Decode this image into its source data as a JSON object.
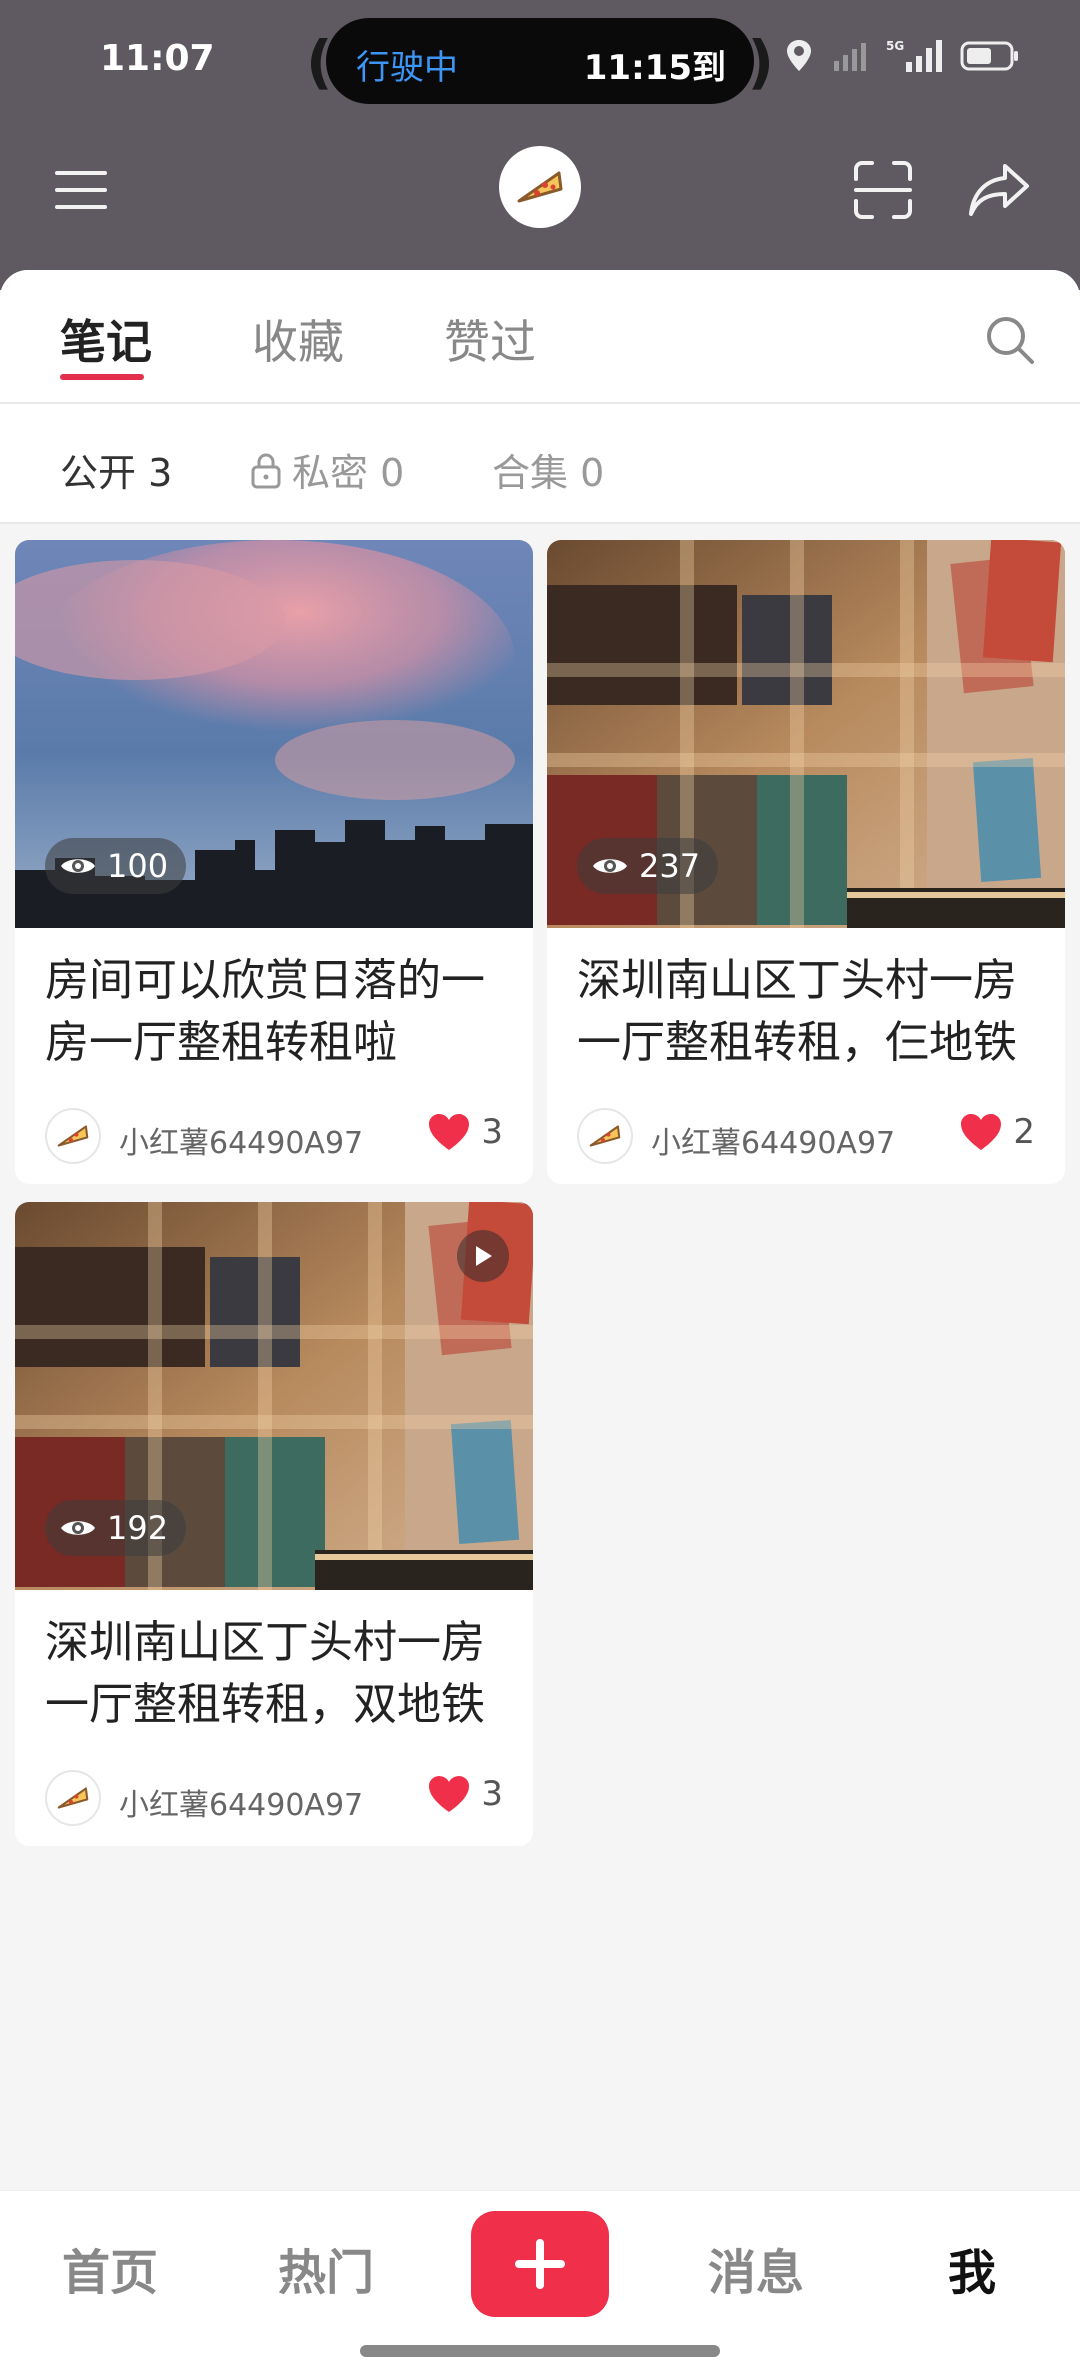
{
  "status_bar": {
    "time": "11:07",
    "nav_status": "行驶中",
    "eta": "11:15到",
    "network": "5G"
  },
  "header": {
    "menu_icon": "hamburger-icon",
    "avatar_icon": "pizza-slice-icon",
    "scan_icon": "scan-icon",
    "share_icon": "share-arrow-icon"
  },
  "tabs": [
    {
      "label": "笔记",
      "active": true
    },
    {
      "label": "收藏",
      "active": false
    },
    {
      "label": "赞过",
      "active": false
    }
  ],
  "subtabs": [
    {
      "label": "公开 3",
      "active": true
    },
    {
      "label": "私密 0",
      "active": false,
      "icon": "lock-icon"
    },
    {
      "label": "合集 0",
      "active": false
    }
  ],
  "notes": [
    {
      "title": "房间可以欣赏日落的一房一厅整租转租啦",
      "views": "100",
      "author": "小红薯64490A97",
      "likes": "3",
      "is_video": false
    },
    {
      "title": "深圳南山区丁头村一房一厅整租转租，仨地铁",
      "views": "237",
      "author": "小红薯64490A97",
      "likes": "2",
      "is_video": false
    },
    {
      "title": "深圳南山区丁头村一房一厅整租转租，双地铁",
      "views": "192",
      "author": "小红薯64490A97",
      "likes": "3",
      "is_video": true
    }
  ],
  "bottom_nav": [
    {
      "label": "首页",
      "active": false
    },
    {
      "label": "热门",
      "active": false
    },
    {
      "label": "消息",
      "active": false
    },
    {
      "label": "我",
      "active": true
    }
  ],
  "colors": {
    "accent": "#e4304c",
    "header_bg": "#5f5a62",
    "plus_button": "#f0304b"
  }
}
